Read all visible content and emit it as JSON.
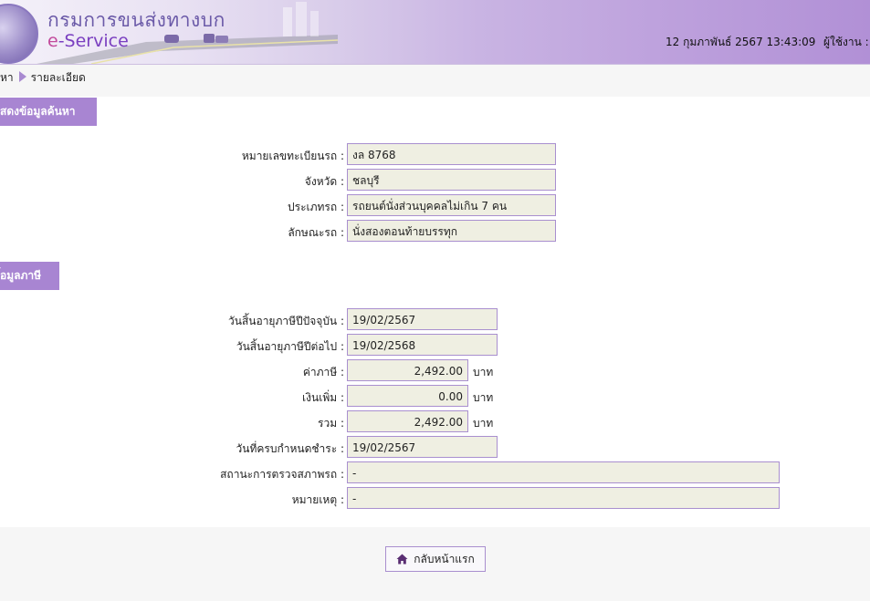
{
  "header": {
    "brand_thai": "กรมการขนส่งทางบก",
    "brand_e": "e",
    "brand_service": "-Service",
    "datetime": "12 กุมภาพันธ์ 2567 13:43:09",
    "user_label": "ผู้ใช้งาน :"
  },
  "breadcrumb": {
    "prev": "หา",
    "current": "รายละเอียด"
  },
  "section1": {
    "title": "สดงข้อมูลค้นหา",
    "rows": [
      {
        "label": "หมายเลขทะเบียนรถ :",
        "value": "งล 8768"
      },
      {
        "label": "จังหวัด :",
        "value": "ชลบุรี"
      },
      {
        "label": "ประเภทรถ :",
        "value": "รถยนต์นั่งส่วนบุคคลไม่เกิน 7 คน"
      },
      {
        "label": "ลักษณะรถ :",
        "value": "นั่งสองตอนท้ายบรรทุก"
      }
    ]
  },
  "section2": {
    "title": "้อมูลภาษี",
    "rows": [
      {
        "label": "วันสิ้นอายุภาษีปีปัจจุบัน :",
        "value": "19/02/2567"
      },
      {
        "label": "วันสิ้นอายุภาษีปีต่อไป :",
        "value": "19/02/2568"
      },
      {
        "label": "ค่าภาษี :",
        "value": "2,492.00",
        "unit": "บาท"
      },
      {
        "label": "เงินเพิ่ม :",
        "value": "0.00",
        "unit": "บาท"
      },
      {
        "label": "รวม :",
        "value": "2,492.00",
        "unit": "บาท"
      },
      {
        "label": "วันที่ครบกำหนดชำระ :",
        "value": "19/02/2567"
      },
      {
        "label": "สถานะการตรวจสภาพรถ :",
        "value": "-"
      },
      {
        "label": "หมายเหตุ :",
        "value": "-"
      }
    ]
  },
  "home_button": {
    "label": "กลับหน้าแรก",
    "icon": "home-icon"
  },
  "colors": {
    "accent": "#a885d2",
    "field_bg": "#efefe2",
    "field_border": "#a98fcf"
  }
}
